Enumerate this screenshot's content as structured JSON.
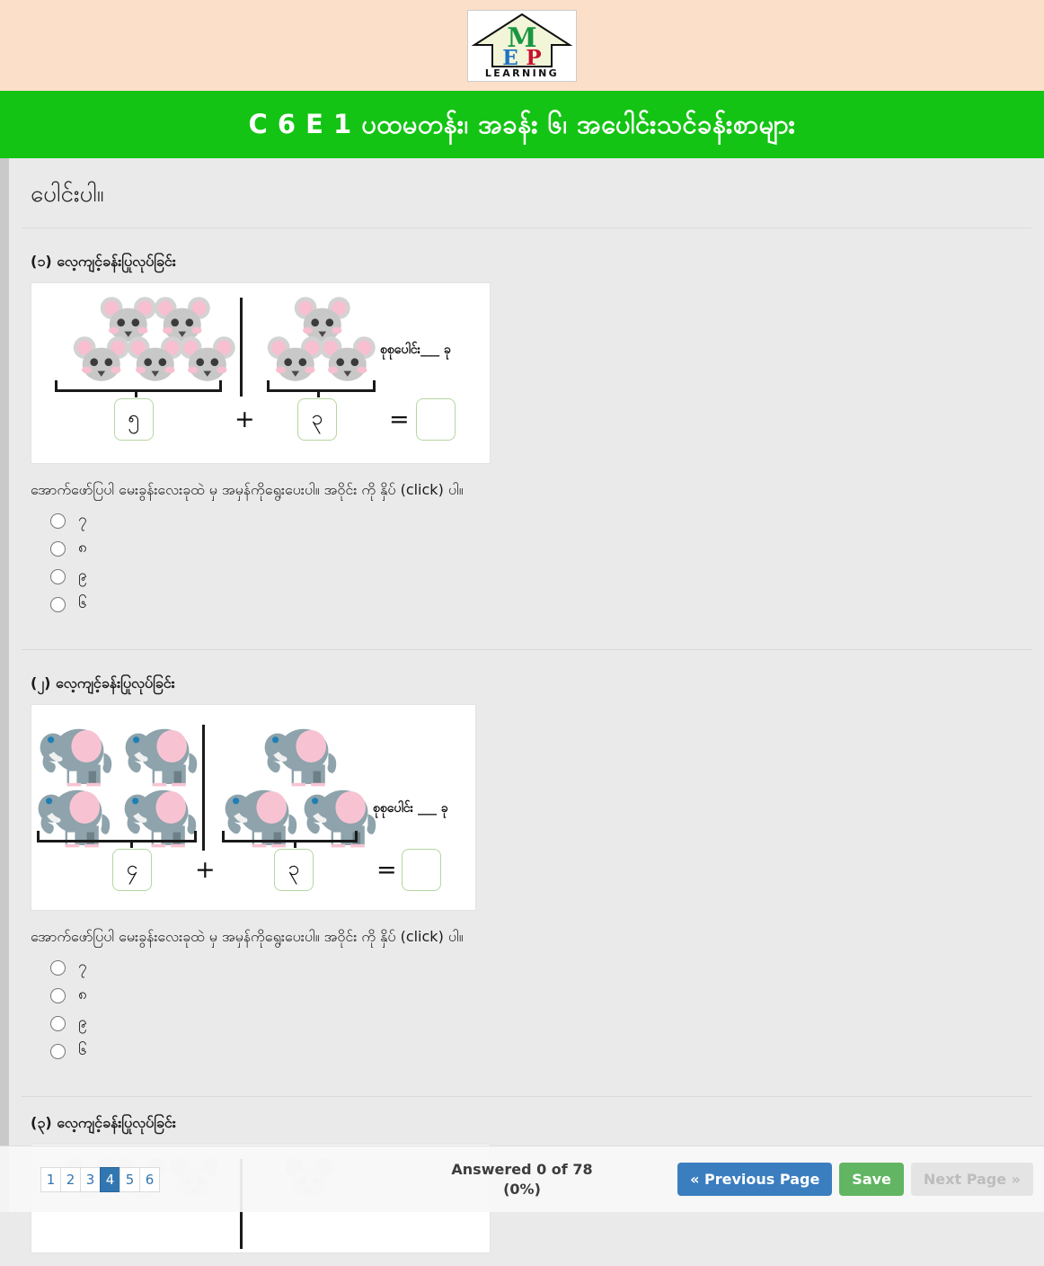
{
  "header": {
    "logo": {
      "name": "mep-learning-logo",
      "letter_m": "M",
      "letter_e": "E",
      "letter_p": "P",
      "wordmark": "LEARNING",
      "color_m": "#1a9641",
      "color_e": "#1f72c4",
      "color_p": "#c8102e",
      "band_color": "#fbdfc9"
    },
    "title": "C 6 E 1 ပထမတန်း၊ အခန်း ၆၊ အပေါင်းသင်ခန်းစာများ",
    "title_bar_color": "#14c414"
  },
  "page": {
    "section_title": "ပေါင်းပါ။"
  },
  "exercises": [
    {
      "heading": "(၁) လေ့ကျင့်ခန်းပြုလုပ်ခြင်း",
      "figure": {
        "animal": "mouse",
        "left_count": 5,
        "right_count": 3,
        "left_box_value": "၅",
        "right_box_value": "၃",
        "result_box_value": "",
        "plus_sign": "+",
        "equals_sign": "=",
        "total_label": "စုစုပေါင်း___ ခု",
        "box_border_color": "#b5d6a0"
      },
      "prompt": "အောက်ဖော်ပြပါ မေးခွန်းလေးခုထဲ မှ အမှန်ကိုရွေးပေးပါ။ အဝိုင်း  ကို နှိပ် (click) ပါ။",
      "options": [
        "၇",
        "၈",
        "၉",
        "၆"
      ]
    },
    {
      "heading": "(၂) လေ့ကျင့်ခန်းပြုလုပ်ခြင်း",
      "figure": {
        "animal": "elephant",
        "left_count": 4,
        "right_count": 3,
        "left_box_value": "၄",
        "right_box_value": "၃",
        "result_box_value": "",
        "plus_sign": "+",
        "equals_sign": "=",
        "total_label": "စုစုပေါင်း ___ ခု",
        "box_border_color": "#b5d6a0"
      },
      "prompt": "အောက်ဖော်ပြပါ မေးခွန်းလေးခုထဲ မှ အမှန်ကိုရွေးပေးပါ။ အဝိုင်း  ကို နှိပ် (click) ပါ။",
      "options": [
        "၇",
        "၈",
        "၉",
        "၆"
      ]
    },
    {
      "heading": "(၃) လေ့ကျင့်ခန်းပြုလုပ်ခြင်း",
      "figure": {
        "animal": "panda"
      }
    }
  ],
  "footer": {
    "pages": [
      "1",
      "2",
      "3",
      "4",
      "5",
      "6"
    ],
    "active_page": "4",
    "answered_line1": "Answered 0 of 78",
    "answered_line2": "(0%)",
    "previous_label": "« Previous Page",
    "save_label": "Save",
    "next_label": "Next Page »",
    "previous_color": "#3a7ebf",
    "save_color": "#62b563",
    "next_color": "#e4e4e4"
  }
}
